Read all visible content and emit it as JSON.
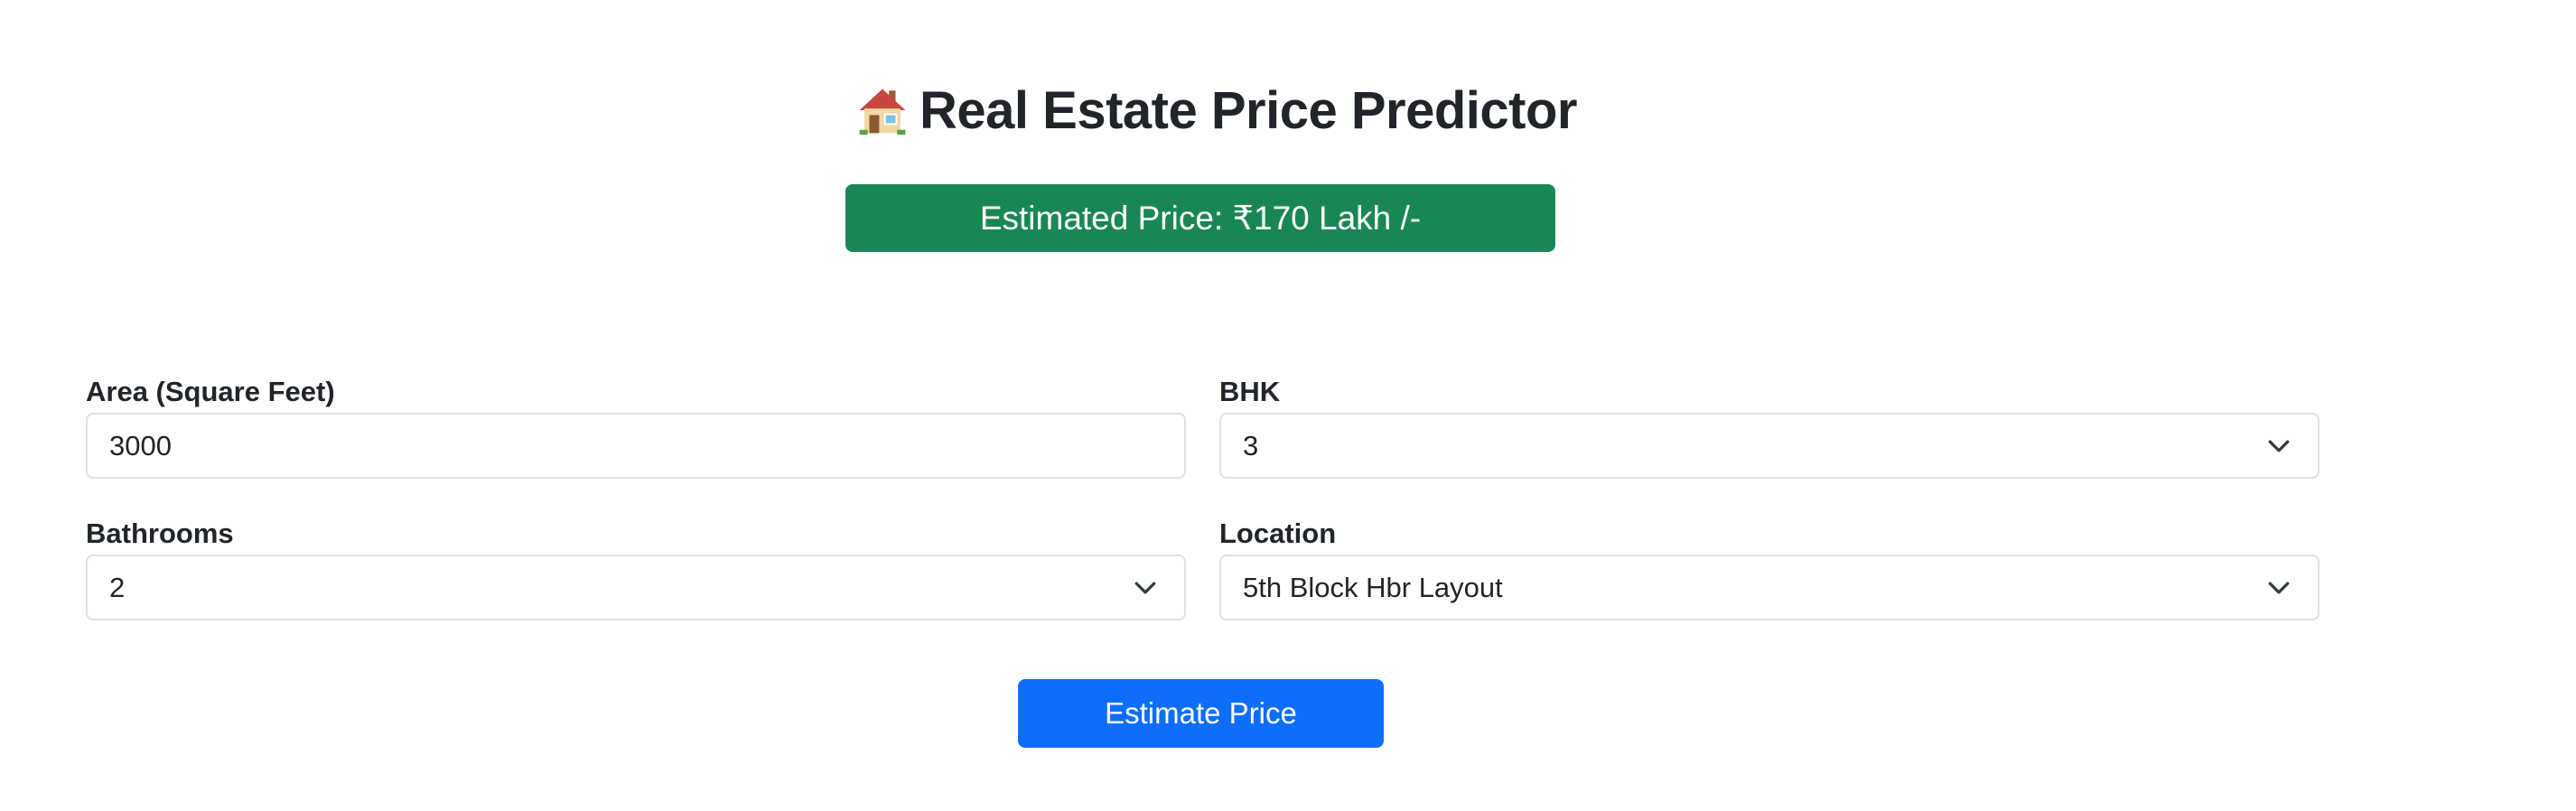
{
  "header": {
    "icon": "house-icon",
    "title": "Real Estate Price Predictor"
  },
  "result": {
    "text": "Estimated Price: ₹170 Lakh /-",
    "color": "#198754"
  },
  "form": {
    "area": {
      "label": "Area (Square Feet)",
      "value": "3000"
    },
    "bhk": {
      "label": "BHK",
      "value": "3"
    },
    "bathrooms": {
      "label": "Bathrooms",
      "value": "2"
    },
    "location": {
      "label": "Location",
      "value": "5th Block Hbr Layout"
    }
  },
  "submit": {
    "label": "Estimate Price",
    "color": "#0d6efd"
  }
}
